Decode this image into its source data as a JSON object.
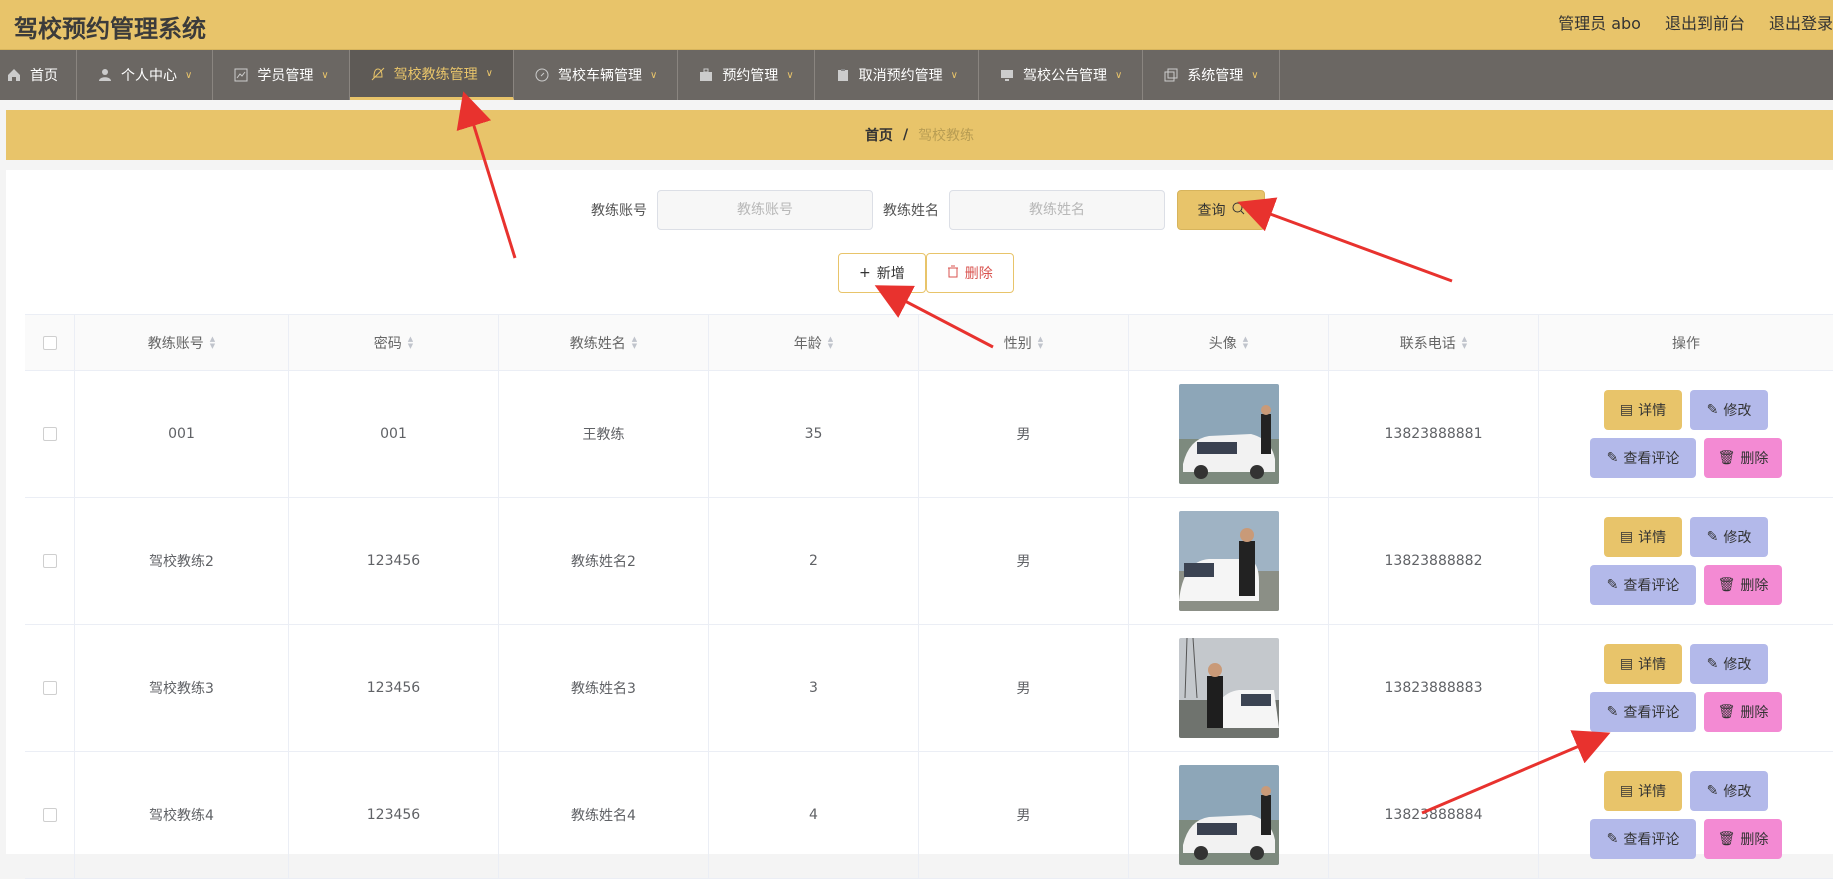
{
  "app": {
    "title": "驾校预约管理系统"
  },
  "top_links": [
    "管理员 abo",
    "退出到前台",
    "退出登录"
  ],
  "nav": [
    {
      "label": "首页",
      "icon": "home-icon",
      "has_caret": false
    },
    {
      "label": "个人中心",
      "icon": "user-icon",
      "has_caret": true
    },
    {
      "label": "学员管理",
      "icon": "chart-icon",
      "has_caret": true
    },
    {
      "label": "驾校教练管理",
      "icon": "bell-off-icon",
      "has_caret": true,
      "active": true
    },
    {
      "label": "驾校车辆管理",
      "icon": "compass-icon",
      "has_caret": true
    },
    {
      "label": "预约管理",
      "icon": "briefcase-icon",
      "has_caret": true
    },
    {
      "label": "取消预约管理",
      "icon": "clipboard-icon",
      "has_caret": true
    },
    {
      "label": "驾校公告管理",
      "icon": "monitor-icon",
      "has_caret": true
    },
    {
      "label": "系统管理",
      "icon": "copy-icon",
      "has_caret": true
    }
  ],
  "breadcrumb": {
    "home": "首页",
    "sep": "/",
    "current": "驾校教练"
  },
  "search": {
    "account_label": "教练账号",
    "account_placeholder": "教练账号",
    "name_label": "教练姓名",
    "name_placeholder": "教练姓名",
    "query_label": "查询"
  },
  "actions": {
    "add_label": "新增",
    "delete_label": "删除"
  },
  "table": {
    "headers": [
      "教练账号",
      "密码",
      "教练姓名",
      "年龄",
      "性别",
      "头像",
      "联系电话",
      "操作"
    ],
    "rows": [
      {
        "account": "001",
        "password": "001",
        "name": "王教练",
        "age": "35",
        "gender": "男",
        "phone": "13823888881"
      },
      {
        "account": "驾校教练2",
        "password": "123456",
        "name": "教练姓名2",
        "age": "2",
        "gender": "男",
        "phone": "13823888882"
      },
      {
        "account": "驾校教练3",
        "password": "123456",
        "name": "教练姓名3",
        "age": "3",
        "gender": "男",
        "phone": "13823888883"
      },
      {
        "account": "驾校教练4",
        "password": "123456",
        "name": "教练姓名4",
        "age": "4",
        "gender": "男",
        "phone": "13823888884"
      }
    ],
    "row_ops": {
      "detail": "详情",
      "edit": "修改",
      "review": "查看评论",
      "delete": "删除"
    }
  },
  "colors": {
    "accent": "#e8c46a",
    "nav_bg": "#6b6763",
    "purple_btn": "#b3b9ea",
    "pink_btn": "#f38ad3",
    "annotation_arrow": "#e8322e"
  }
}
